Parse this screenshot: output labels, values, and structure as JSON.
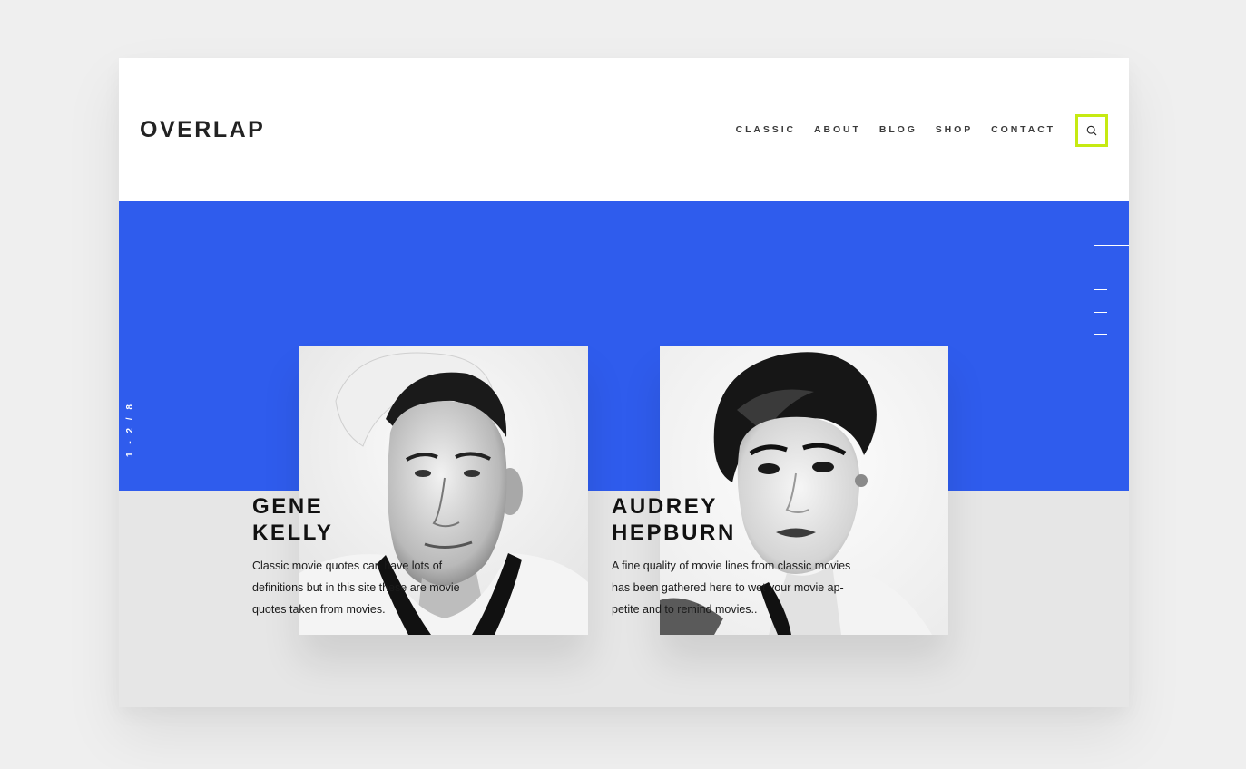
{
  "brand": {
    "logo": "OVERLAP",
    "accent_color": "#c6ea12",
    "hero_color": "#2f5ced"
  },
  "nav": {
    "items": [
      {
        "label": "CLASSIC"
      },
      {
        "label": "ABOUT"
      },
      {
        "label": "BLOG"
      },
      {
        "label": "SHOP"
      },
      {
        "label": "CONTACT"
      }
    ],
    "search_icon": "search-icon"
  },
  "slider": {
    "counter": "1 - 2 / 8",
    "pager_count": 5,
    "active_index": 0
  },
  "cards": [
    {
      "first_name": "GENE",
      "last_name": "KELLY",
      "description": "Classic movie quotes can have lots of definitions but in this site these are movie quotes taken from movies.",
      "photo": "black-and-white portrait of man in sailor uniform"
    },
    {
      "first_name": "AUDREY",
      "last_name": "HEPBURN",
      "description": "A fine quality of movie lines from classic movies has been gathered here to wet your movie ap-petite and to remind movies..",
      "photo": "black-and-white portrait of woman with short hair"
    }
  ]
}
